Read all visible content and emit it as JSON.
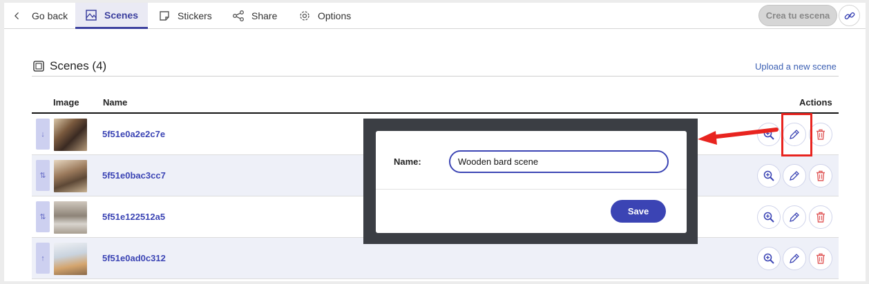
{
  "nav": {
    "back_label": "Go back",
    "tabs": [
      {
        "label": "Scenes",
        "icon": "scenes-icon",
        "active": true
      },
      {
        "label": "Stickers",
        "icon": "sticker-icon",
        "active": false
      },
      {
        "label": "Share",
        "icon": "share-icon",
        "active": false
      },
      {
        "label": "Options",
        "icon": "gear-icon",
        "active": false
      }
    ],
    "cta_label": "Crea tu escena",
    "link_icon": "link-icon"
  },
  "section": {
    "title": "Scenes (4)",
    "upload_label": "Upload a new scene"
  },
  "table": {
    "columns": {
      "image": "Image",
      "name": "Name",
      "actions": "Actions"
    },
    "rows": [
      {
        "name": "5f51e0a2e2c7e",
        "drag": "↓"
      },
      {
        "name": "5f51e0bac3cc7",
        "drag": "⇅"
      },
      {
        "name": "5f51e122512a5",
        "drag": "⇅"
      },
      {
        "name": "5f51e0ad0c312",
        "drag": "↑"
      }
    ],
    "action_icons": [
      "zoom-icon",
      "pencil-icon",
      "trash-icon"
    ]
  },
  "modal": {
    "name_label": "Name:",
    "name_value": "Wooden bard scene",
    "save_label": "Save"
  },
  "colors": {
    "accent": "#3b44b4",
    "highlight": "#e8241f",
    "delete": "#e05a5a"
  }
}
